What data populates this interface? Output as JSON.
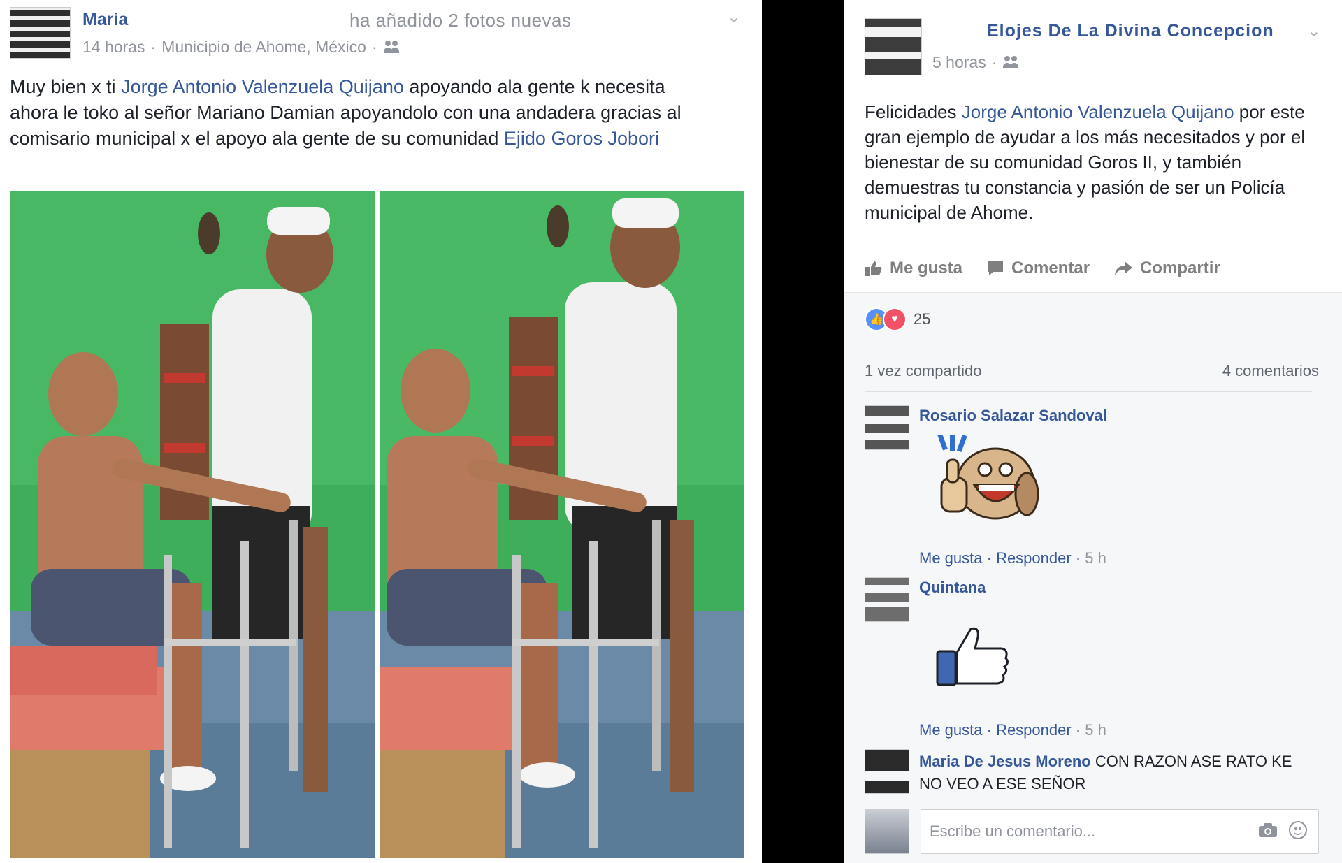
{
  "left_post": {
    "author": "Maria",
    "action": "ha añadido 2 fotos nuevas",
    "time": "14 horas",
    "location": "Municipio de Ahome, México",
    "text_parts": {
      "p1": "Muy bien x ti ",
      "mention1": "Jorge Antonio Valenzuela Quijano",
      "p2": " apoyando ala gente k necesita ahora le toko al señor Mariano Damian apoyandolo con una andadera gracias al comisario municipal x el apoyo ala gente de su comunidad ",
      "mention2": "Ejido Goros Jobori"
    },
    "photos": [
      "photo-1",
      "photo-2"
    ]
  },
  "right_post": {
    "author": "Elojes De La Divina Concepcion",
    "time": "5 horas",
    "text_parts": {
      "p1": "Felicidades ",
      "mention": "Jorge Antonio Valenzuela Quijano",
      "p2": " por este gran ejemplo de ayudar a los más necesitados y por el bienestar de su comunidad Goros II, y también demuestras tu constancia y pasión de ser un Policía municipal de Ahome."
    },
    "actions": {
      "like": "Me gusta",
      "comment": "Comentar",
      "share": "Compartir"
    },
    "reactions": {
      "count": "25",
      "icons": [
        "like-icon",
        "love-icon"
      ]
    },
    "shares": "1 vez compartido",
    "comments_count": "4 comentarios",
    "comments": [
      {
        "name": "Rosario Salazar Sandoval",
        "content_type": "sticker",
        "like": "Me gusta",
        "reply": "Responder",
        "time": "5 h"
      },
      {
        "name": "Quintana",
        "content_type": "thumbs-up",
        "like": "Me gusta",
        "reply": "Responder",
        "time": "5 h"
      },
      {
        "name": "Maria De Jesus Moreno",
        "text": "CON RAZON ASE RATO KE NO VEO A ESE SEÑOR"
      }
    ],
    "comment_box": {
      "placeholder": "Escribe un comentario..."
    }
  },
  "colors": {
    "link": "#365899",
    "muted": "#90949c",
    "like_blue": "#5890ff",
    "love_red": "#f25268",
    "wall_green": "#3fae5a"
  }
}
